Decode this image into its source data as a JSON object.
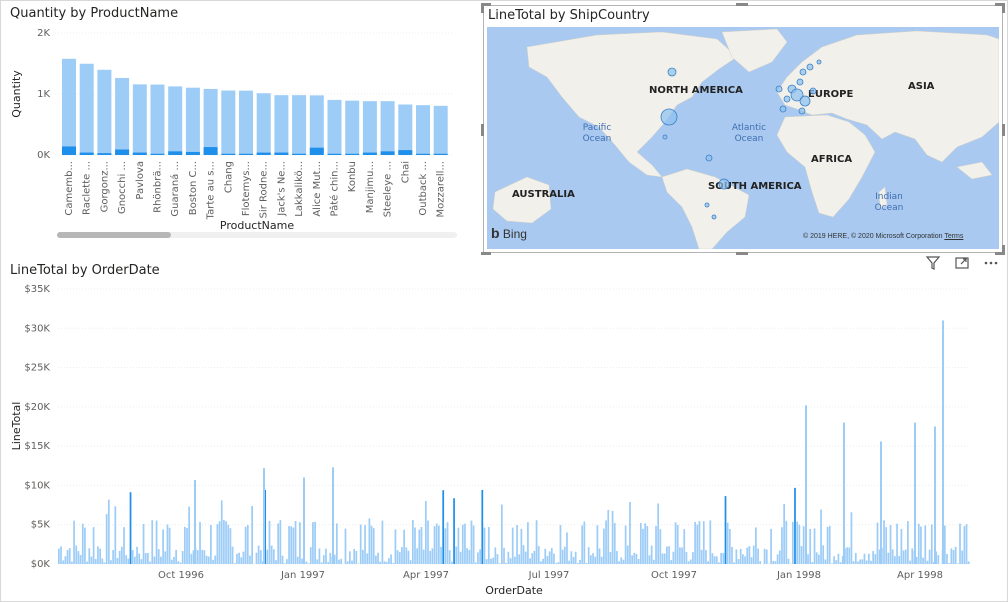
{
  "visuals": {
    "bar": {
      "title": "Quantity by ProductName",
      "xlabel": "ProductName",
      "ylabel": "Quantity",
      "yticks": [
        "2K",
        "1K",
        "0K"
      ]
    },
    "map": {
      "title": "LineTotal by ShipCountry",
      "continents": [
        "NORTH AMERICA",
        "EUROPE",
        "ASIA",
        "AFRICA",
        "SOUTH AMERICA",
        "AUSTRALIA"
      ],
      "oceans": [
        [
          "Pacific",
          "Ocean"
        ],
        [
          "Atlantic",
          "Ocean"
        ],
        [
          "Indian",
          "Ocean"
        ]
      ],
      "bing_label": "Bing",
      "copyright": "© 2019 HERE, © 2020 Microsoft Corporation",
      "terms_label": "Terms"
    },
    "line": {
      "title": "LineTotal by OrderDate",
      "xlabel": "OrderDate",
      "ylabel": "LineTotal",
      "yticks": [
        "$35K",
        "$30K",
        "$25K",
        "$20K",
        "$15K",
        "$10K",
        "$5K",
        "$0K"
      ],
      "xticks": [
        "Oct 1996",
        "Jan 1997",
        "Apr 1997",
        "Jul 1997",
        "Oct 1997",
        "Jan 1998",
        "Apr 1998"
      ]
    }
  },
  "header_icons": [
    "filter-icon",
    "focus-mode-icon",
    "more-options-icon"
  ],
  "colors": {
    "bar_main": "#9dcdf7",
    "bar_highlight": "#1f8fec",
    "map_water": "#a9c9f0",
    "map_land": "#f2f0ea"
  },
  "chart_data": [
    {
      "type": "bar",
      "title": "Quantity by ProductName",
      "xlabel": "ProductName",
      "ylabel": "Quantity",
      "ylim": [
        0,
        2000
      ],
      "categories": [
        "Camemb...",
        "Raclette ...",
        "Gorgonz...",
        "Gnocchi ...",
        "Pavlova",
        "Rhönbrä...",
        "Guaraná ...",
        "Boston C...",
        "Tarte au s...",
        "Chang",
        "Flotemys...",
        "Sir Rodne...",
        "Jack's Ne...",
        "Lakkalikö...",
        "Alice Mut...",
        "Pâté chin...",
        "Konbu",
        "Manjimu...",
        "Steeleye ...",
        "Chai",
        "Outback ...",
        "Mozzarell..."
      ],
      "series": [
        {
          "values": [
            1577,
            1496,
            1397,
            1263,
            1158,
            1155,
            1125,
            1103,
            1083,
            1057,
            1055,
            1012,
            981,
            981,
            978,
            903,
            891,
            882,
            883,
            828,
            817,
            806
          ]
        },
        {
          "values": [
            140,
            40,
            30,
            90,
            40,
            20,
            60,
            50,
            130,
            20,
            20,
            40,
            40,
            20,
            120,
            20,
            20,
            40,
            60,
            80,
            20,
            20
          ]
        }
      ]
    },
    {
      "type": "bar",
      "title": "LineTotal by OrderDate",
      "xlabel": "OrderDate",
      "ylabel": "LineTotal",
      "ylim": [
        0,
        35000
      ],
      "x_range": [
        "Jul 1996",
        "May 1998"
      ],
      "notable_peaks": [
        {
          "x": "Apr 1998",
          "y": 31000
        },
        {
          "x": "Jan 1998",
          "y": 20200
        },
        {
          "x": "Apr 1998",
          "y": 18000
        },
        {
          "x": "Feb 1998",
          "y": 18000
        },
        {
          "x": "Apr 1998",
          "y": 17500
        },
        {
          "x": "Mar 1998",
          "y": 15600
        },
        {
          "x": "Dec 1996",
          "y": 12200
        },
        {
          "x": "Feb 1997",
          "y": 12300
        },
        {
          "x": "Jan 1997",
          "y": 11000
        },
        {
          "x": "Nov 1996",
          "y": 10700
        }
      ]
    }
  ]
}
